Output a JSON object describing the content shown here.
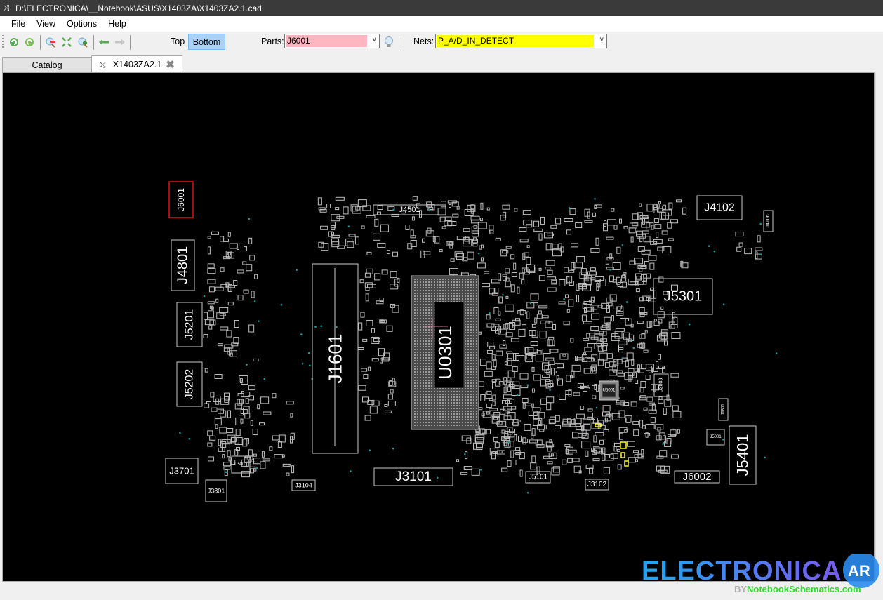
{
  "window": {
    "title": "D:\\ELECTRONICA\\__Notebook\\ASUS\\X1403ZA\\X1403ZA2.1.cad",
    "icon": "shuffle-icon"
  },
  "menu": [
    "File",
    "View",
    "Options",
    "Help"
  ],
  "toolbar": {
    "buttons": [
      {
        "name": "rotate-left-icon"
      },
      {
        "name": "rotate-right-icon"
      },
      {
        "name": "zoom-out-icon"
      },
      {
        "name": "fit-to-screen-icon"
      },
      {
        "name": "zoom-in-icon"
      },
      {
        "name": "back-arrow-icon"
      },
      {
        "name": "forward-arrow-icon"
      }
    ],
    "side_top": "Top",
    "side_bottom": "Bottom",
    "parts_label": "Parts:",
    "parts_value": "J6001",
    "parts_highlight": "#ffb6c1",
    "nets_label": "Nets:",
    "nets_value": "P_A/D_IN_DETECT",
    "nets_highlight": "#ffff00"
  },
  "tabs": [
    {
      "label": "Catalog",
      "active": false
    },
    {
      "label": "X1403ZA2.1",
      "active": true,
      "icon": "shuffle-icon",
      "close": "close-icon"
    }
  ],
  "board": {
    "colors": {
      "background": "#000000",
      "outline": "#c8c8c8",
      "selected": "#e01010",
      "net": "#ffff00",
      "testpoint": "#1a9a9a",
      "label": "#ffffff"
    },
    "selected_part": "J6001",
    "parts": [
      {
        "ref": "J6001",
        "selected": true
      },
      {
        "ref": "J4801"
      },
      {
        "ref": "J5201"
      },
      {
        "ref": "J5202"
      },
      {
        "ref": "J3701"
      },
      {
        "ref": "J3801"
      },
      {
        "ref": "U5801"
      },
      {
        "ref": "J3104"
      },
      {
        "ref": "J1601"
      },
      {
        "ref": "J4501"
      },
      {
        "ref": "U0301"
      },
      {
        "ref": "J3101"
      },
      {
        "ref": "J5101"
      },
      {
        "ref": "J3102"
      },
      {
        "ref": "J4102"
      },
      {
        "ref": "J4106"
      },
      {
        "ref": "J5301"
      },
      {
        "ref": "U5001"
      },
      {
        "ref": "U2803"
      },
      {
        "ref": "J6801"
      },
      {
        "ref": "J5001"
      },
      {
        "ref": "J5401"
      },
      {
        "ref": "J6002"
      }
    ]
  },
  "watermark": {
    "brand": "ELECTRONICA",
    "badge": "AR",
    "byline_prefix": "BY",
    "byline_site": "NotebookSchematics.com"
  }
}
